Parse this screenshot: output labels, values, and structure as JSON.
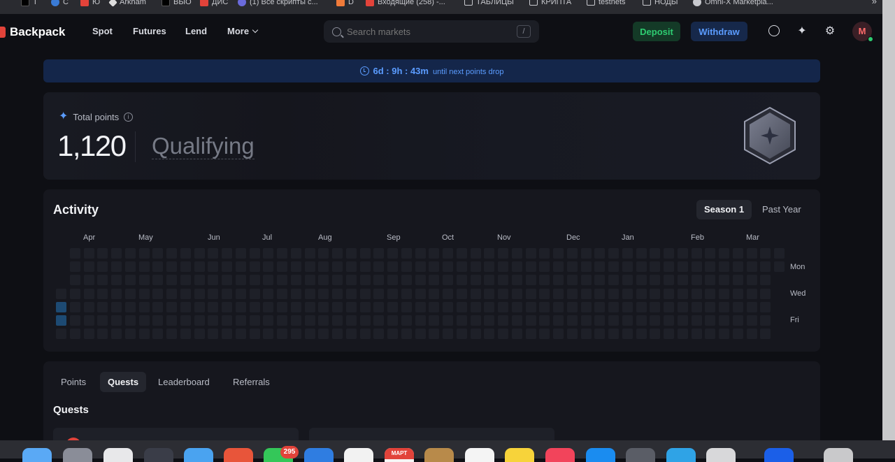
{
  "bookmarks": [
    {
      "label": "Т",
      "color": "#000000"
    },
    {
      "label": "С",
      "color": "#3a7bd5"
    },
    {
      "label": "Ю",
      "color": "#e2433a"
    },
    {
      "label": "Arkham",
      "color": "#ffffff"
    },
    {
      "label": "ВЫО",
      "color": "#000000"
    },
    {
      "label": "ДИС",
      "color": "#e2433a"
    },
    {
      "label": "(1) Все скрипты с...",
      "color": "#6b6bdc"
    },
    {
      "label": "D",
      "color": "#f07b3a"
    },
    {
      "label": "Входящие (258) -...",
      "color": "#e2433a"
    },
    {
      "label": "ТАБЛИЦЫ",
      "color": "folder"
    },
    {
      "label": "КРИПТА",
      "color": "folder"
    },
    {
      "label": "testnets",
      "color": "folder"
    },
    {
      "label": "НОДЫ",
      "color": "folder"
    },
    {
      "label": "Omni-X Marketpla...",
      "color": "#c8c9ce"
    }
  ],
  "bookmarks_more": "»",
  "nav": {
    "brand": "Backpack",
    "links": [
      "Spot",
      "Futures",
      "Lend",
      "More"
    ],
    "search_placeholder": "Search markets",
    "search_shortcut": "/",
    "deposit_label": "Deposit",
    "withdraw_label": "Withdraw",
    "avatar_initial": "M"
  },
  "banner": {
    "timer": "6d : 9h : 43m",
    "note": "until next points drop"
  },
  "points": {
    "label": "Total points",
    "value": "1,120",
    "status": "Qualifying"
  },
  "activity": {
    "title": "Activity",
    "range_options": [
      "Season 1",
      "Past Year"
    ],
    "selected_range": "Season 1",
    "months": [
      "Apr",
      "May",
      "Jun",
      "Jul",
      "Aug",
      "Sep",
      "Oct",
      "Nov",
      "Dec",
      "Jan",
      "Feb",
      "Mar"
    ],
    "day_labels": [
      "Mon",
      "Wed",
      "Fri"
    ],
    "active_days": [
      {
        "week": 0,
        "day": "Thu"
      },
      {
        "week": 0,
        "day": "Fri"
      }
    ]
  },
  "tabs": {
    "items": [
      "Points",
      "Quests",
      "Leaderboard",
      "Referrals"
    ],
    "selected": "Quests",
    "section_title": "Quests"
  },
  "dock": {
    "messages_badge": "295",
    "calendar_month": "МАРТ"
  },
  "colors": {
    "accent_blue": "#5b9cff",
    "deposit_green": "#2ecc71",
    "brand_red": "#e2433a"
  }
}
